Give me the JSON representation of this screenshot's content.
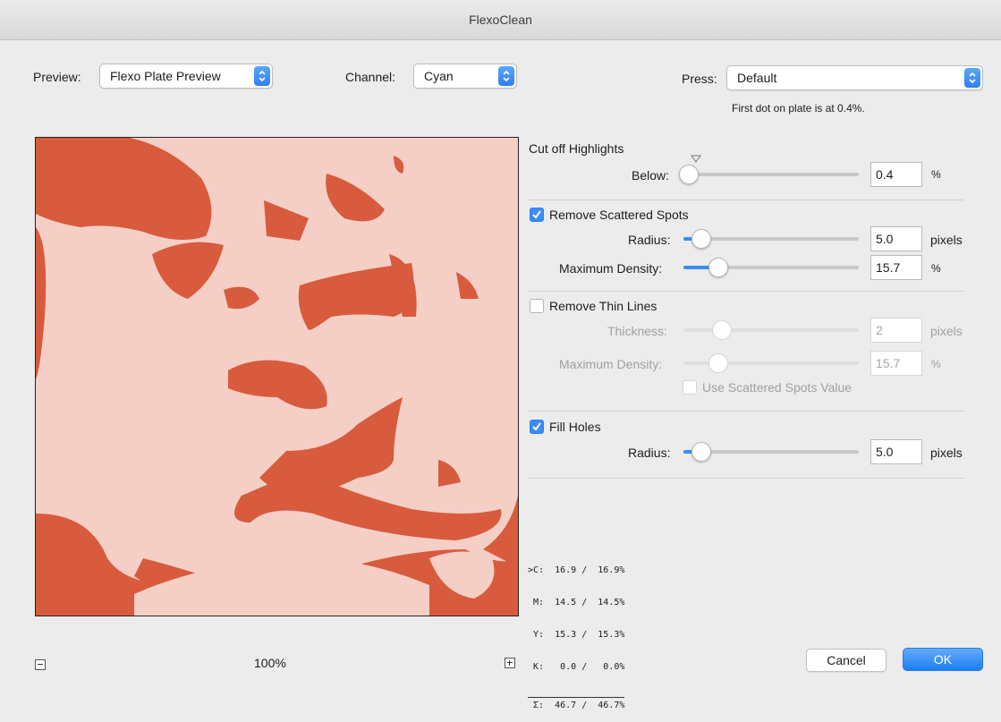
{
  "window": {
    "title": "FlexoClean"
  },
  "preview_popup": {
    "label": "Preview:",
    "value": "Flexo Plate Preview"
  },
  "channel_popup": {
    "label": "Channel:",
    "value": "Cyan"
  },
  "press_popup": {
    "label": "Press:",
    "value": "Default",
    "note": "First dot on plate is at 0.4%."
  },
  "highlights": {
    "title": "Cut off Highlights",
    "below_label": "Below:",
    "below_value": "0.4",
    "below_unit": "%",
    "below_fraction": 0.03
  },
  "scattered": {
    "label": "Remove Scattered Spots",
    "checked": true,
    "radius_label": "Radius:",
    "radius_value": "5.0",
    "radius_unit": "pixels",
    "radius_fraction": 0.1,
    "density_label": "Maximum Density:",
    "density_value": "15.7",
    "density_unit": "%",
    "density_fraction": 0.2
  },
  "thin_lines": {
    "label": "Remove Thin Lines",
    "checked": false,
    "thickness_label": "Thickness:",
    "thickness_value": "2",
    "thickness_unit": "pixels",
    "thickness_fraction": 0.22,
    "density_label": "Maximum Density:",
    "density_value": "15.7",
    "density_unit": "%",
    "density_fraction": 0.2,
    "use_scattered_label": "Use Scattered Spots Value"
  },
  "fill_holes": {
    "label": "Fill Holes",
    "checked": true,
    "radius_label": "Radius:",
    "radius_value": "5.0",
    "radius_unit": "pixels",
    "radius_fraction": 0.1
  },
  "readout": {
    "c": ">C:  16.9 /  16.9%",
    "m": " M:  14.5 /  14.5%",
    "y": " Y:  15.3 /  15.3%",
    "k": " K:   0.0 /   0.0%",
    "sum": " Σ:  46.7 /  46.7%"
  },
  "zoom": {
    "level": "100%"
  },
  "buttons": {
    "cancel": "Cancel",
    "ok": "OK"
  },
  "colors": {
    "plate": "#d75b3c",
    "plate_bg": "#f5cfc6",
    "accent": "#3b8cf5"
  },
  "icons": [
    "chevron-updown-icon",
    "checkmark-icon",
    "zoom-out-icon",
    "zoom-in-icon",
    "marker-triangle-icon"
  ]
}
